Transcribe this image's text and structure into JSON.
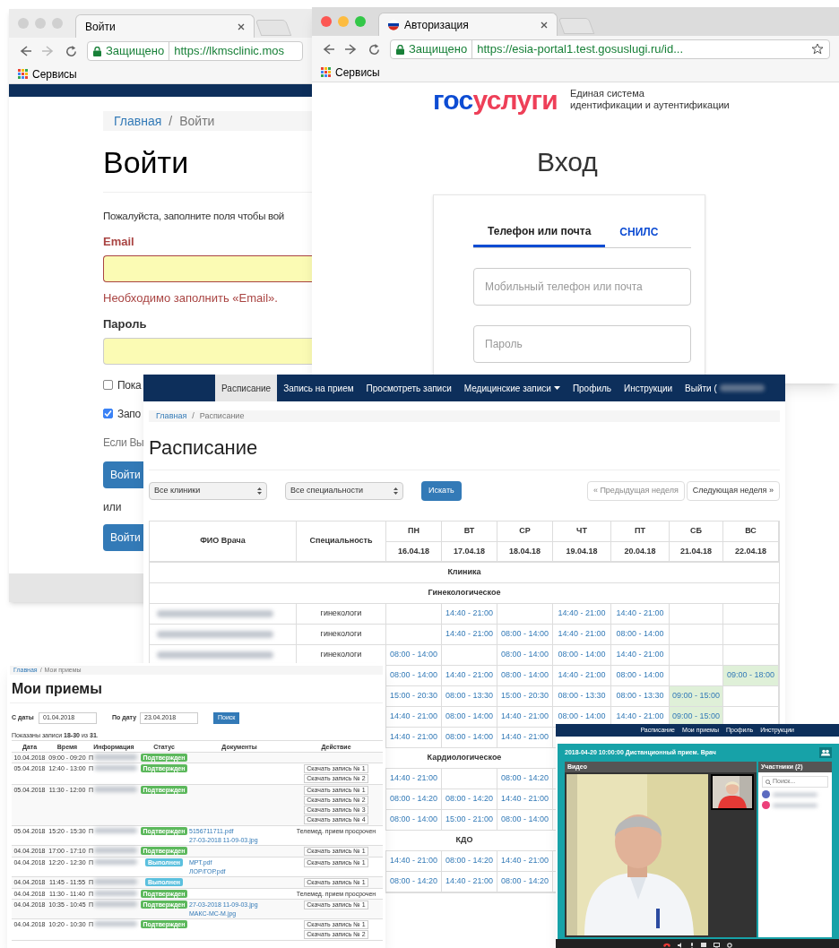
{
  "login_window": {
    "tab_title": "Войти",
    "secure_label": "Защищено",
    "url": "https://lkmsclinic.mos",
    "bookmark": "Сервисы",
    "breadcrumb": [
      "Главная",
      "/",
      "Войти"
    ],
    "heading": "Войти",
    "intro": "Пожалуйста, заполните поля чтобы вой",
    "fields": [
      {
        "label": "Email",
        "invalid": true,
        "error": "Необходимо заполнить «Email»."
      },
      {
        "label": "Пароль",
        "invalid": false
      }
    ],
    "checkboxes": [
      {
        "label": "Пока",
        "checked": false
      },
      {
        "label": "Запо",
        "checked": true
      }
    ],
    "note": "Если Вы",
    "buttons": [
      "Войти",
      "Войти"
    ],
    "or_label": "или"
  },
  "esia_window": {
    "tab_title": "Авторизация",
    "secure_label": "Защищено",
    "url": "https://esia-portal1.test.gosuslugi.ru/id...",
    "bookmark": "Сервисы",
    "logo_left": "гос",
    "logo_right": "услуги",
    "tagline": [
      "Единая система",
      "идентификации и аутентификации"
    ],
    "heading": "Вход",
    "tabs": [
      {
        "label": "Телефон или почта",
        "selected": true
      },
      {
        "label": "СНИЛС",
        "selected": false
      }
    ],
    "fields": [
      {
        "placeholder": "Мобильный телефон или почта"
      },
      {
        "placeholder": "Пароль"
      }
    ]
  },
  "schedule_window": {
    "nav": [
      {
        "label": "Расписание",
        "selected": true
      },
      {
        "label": "Запись на прием",
        "selected": false
      },
      {
        "label": "Просмотреть записи",
        "selected": false
      },
      {
        "label": "Медицинские записи",
        "selected": false,
        "dropdown": true
      },
      {
        "label": "Профиль",
        "selected": false
      },
      {
        "label": "Инструкции",
        "selected": false
      },
      {
        "label": "Выйти (",
        "selected": false,
        "redacted": true
      }
    ],
    "breadcrumb": [
      "Главная",
      "/",
      "Расписание"
    ],
    "heading": "Расписание",
    "filters": [
      "Все клиники",
      "Все специальности"
    ],
    "search_button": "Искать",
    "pager": [
      {
        "label": "« Предыдущая неделя",
        "disabled": true
      },
      {
        "label": "Следующая неделя »",
        "disabled": false
      }
    ],
    "columns": [
      "ФИО Врача",
      "Специальность"
    ],
    "days": [
      {
        "day": "ПН",
        "date": "16.04.18"
      },
      {
        "day": "ВТ",
        "date": "17.04.18"
      },
      {
        "day": "СР",
        "date": "18.04.18"
      },
      {
        "day": "ЧТ",
        "date": "19.04.18"
      },
      {
        "day": "ПТ",
        "date": "20.04.18"
      },
      {
        "day": "СБ",
        "date": "21.04.18"
      },
      {
        "day": "ВС",
        "date": "22.04.18"
      }
    ],
    "rows": [
      {
        "kind": "group",
        "title": "Клиника"
      },
      {
        "kind": "group",
        "title": "Гинекологическое"
      },
      {
        "kind": "doctor",
        "redacted": true,
        "specialty": "гинекологи",
        "slots": [
          {
            "kind": "empty"
          },
          {
            "kind": "time",
            "time": "14:40 - 21:00",
            "highlighted": false
          },
          {
            "kind": "empty"
          },
          {
            "kind": "time",
            "time": "14:40 - 21:00",
            "highlighted": false
          },
          {
            "kind": "time",
            "time": "14:40 - 21:00",
            "highlighted": false
          },
          {
            "kind": "empty"
          },
          {
            "kind": "empty"
          }
        ]
      },
      {
        "kind": "doctor",
        "redacted": true,
        "specialty": "гинекологи",
        "slots": [
          {
            "kind": "empty"
          },
          {
            "kind": "time",
            "time": "14:40 - 21:00",
            "highlighted": false
          },
          {
            "kind": "time",
            "time": "08:00 - 14:00",
            "highlighted": false
          },
          {
            "kind": "time",
            "time": "14:40 - 21:00",
            "highlighted": false
          },
          {
            "kind": "time",
            "time": "08:00 - 14:00",
            "highlighted": false
          },
          {
            "kind": "empty"
          },
          {
            "kind": "empty"
          }
        ]
      },
      {
        "kind": "doctor",
        "redacted": true,
        "specialty": "гинекологи",
        "slots": [
          {
            "kind": "time",
            "time": "08:00 - 14:00",
            "highlighted": false
          },
          {
            "kind": "empty"
          },
          {
            "kind": "time",
            "time": "08:00 - 14:00",
            "highlighted": false
          },
          {
            "kind": "time",
            "time": "08:00 - 14:00",
            "highlighted": false
          },
          {
            "kind": "time",
            "time": "14:40 - 21:00",
            "highlighted": false
          },
          {
            "kind": "empty"
          },
          {
            "kind": "empty"
          }
        ]
      },
      {
        "kind": "doctor",
        "slots": [
          {
            "kind": "time",
            "time": "08:00 - 14:00",
            "highlighted": false
          },
          {
            "kind": "time",
            "time": "14:40 - 21:00",
            "highlighted": false
          },
          {
            "kind": "time",
            "time": "08:00 - 14:00",
            "highlighted": false
          },
          {
            "kind": "time",
            "time": "14:40 - 21:00",
            "highlighted": false
          },
          {
            "kind": "time",
            "time": "08:00 - 14:00",
            "highlighted": false
          },
          {
            "kind": "empty"
          },
          {
            "kind": "time",
            "time": "09:00 - 18:00",
            "highlighted": true
          }
        ]
      },
      {
        "kind": "doctor",
        "slots": [
          {
            "kind": "time",
            "time": "15:00 - 20:30",
            "highlighted": false
          },
          {
            "kind": "time",
            "time": "08:00 - 13:30",
            "highlighted": false
          },
          {
            "kind": "time",
            "time": "15:00 - 20:30",
            "highlighted": false
          },
          {
            "kind": "time",
            "time": "08:00 - 13:30",
            "highlighted": false
          },
          {
            "kind": "time",
            "time": "08:00 - 13:30",
            "highlighted": false
          },
          {
            "kind": "time",
            "time": "09:00 - 15:00",
            "highlighted": true
          },
          {
            "kind": "empty"
          }
        ]
      },
      {
        "kind": "doctor",
        "slots": [
          {
            "kind": "time",
            "time": "14:40 - 21:00",
            "highlighted": false
          },
          {
            "kind": "time",
            "time": "08:00 - 14:00",
            "highlighted": false
          },
          {
            "kind": "time",
            "time": "14:40 - 21:00",
            "highlighted": false
          },
          {
            "kind": "time",
            "time": "08:00 - 14:00",
            "highlighted": false
          },
          {
            "kind": "time",
            "time": "14:40 - 21:00",
            "highlighted": false
          },
          {
            "kind": "time",
            "time": "09:00 - 15:00",
            "highlighted": true
          },
          {
            "kind": "empty"
          }
        ]
      },
      {
        "kind": "doctor",
        "slots": [
          {
            "kind": "time",
            "time": "14:40 - 21:00",
            "highlighted": false
          },
          {
            "kind": "time",
            "time": "08:00 - 14:00",
            "highlighted": false
          },
          {
            "kind": "time",
            "time": "14:40 - 21:00",
            "highlighted": false
          }
        ]
      },
      {
        "kind": "group",
        "title": "Кардиологическое"
      },
      {
        "kind": "doctor",
        "slots": [
          {
            "kind": "time",
            "time": "14:40 - 21:00",
            "highlighted": false
          },
          {
            "kind": "empty"
          },
          {
            "kind": "time",
            "time": "08:00 - 14:20",
            "highlighted": false
          }
        ]
      },
      {
        "kind": "doctor",
        "slots": [
          {
            "kind": "time",
            "time": "08:00 - 14:20",
            "highlighted": false
          },
          {
            "kind": "time",
            "time": "08:00 - 14:20",
            "highlighted": false
          },
          {
            "kind": "time",
            "time": "14:40 - 21:00",
            "highlighted": false
          }
        ]
      },
      {
        "kind": "doctor",
        "slots": [
          {
            "kind": "time",
            "time": "08:00 - 14:00",
            "highlighted": false
          },
          {
            "kind": "time",
            "time": "15:00 - 21:00",
            "highlighted": false
          },
          {
            "kind": "time",
            "time": "08:00 - 14:00",
            "highlighted": false
          }
        ]
      },
      {
        "kind": "group",
        "title": "КДО"
      },
      {
        "kind": "doctor",
        "slots": [
          {
            "kind": "time",
            "time": "14:40 - 21:00",
            "highlighted": false
          },
          {
            "kind": "time",
            "time": "08:00 - 14:20",
            "highlighted": false
          },
          {
            "kind": "time",
            "time": "14:40 - 21:00",
            "highlighted": false
          }
        ]
      },
      {
        "kind": "doctor",
        "slots": [
          {
            "kind": "time",
            "time": "08:00 - 14:20",
            "highlighted": false
          },
          {
            "kind": "time",
            "time": "14:40 - 21:00",
            "highlighted": false
          },
          {
            "kind": "time",
            "time": "08:00 - 14:20",
            "highlighted": false
          }
        ]
      }
    ]
  },
  "appointments_window": {
    "breadcrumb": [
      "Главная",
      "/",
      "Мои приемы"
    ],
    "heading": "Мои приемы",
    "from_label": "С даты",
    "from_value": "01.04.2018",
    "to_label": "По дату",
    "to_value": "23.04.2018",
    "search_button": "Поиск",
    "summary": "Показаны записи **18-30** из **31**.",
    "columns": [
      "Дата",
      "Время",
      "Информация",
      "Статус",
      "Документы",
      "Действие"
    ],
    "rows": [
      {
        "date": "10.04.2018",
        "time": "09:00 - 09:20",
        "info": "П",
        "status": "Подтвержден",
        "kind": "confirmed"
      },
      {
        "date": "05.04.2018",
        "time": "12:40 - 13:00",
        "info": "П",
        "status": "Подтвержден",
        "kind": "confirmed",
        "actions": [
          "Скачать запись № 1",
          "Скачать запись № 2"
        ]
      },
      {
        "date": "05.04.2018",
        "time": "11:30 - 12:00",
        "info": "П",
        "status": "Подтвержден",
        "kind": "confirmed",
        "actions": [
          "Скачать запись № 1",
          "Скачать запись № 2",
          "Скачать запись № 3",
          "Скачать запись № 4"
        ]
      },
      {
        "date": "05.04.2018",
        "time": "15:20 - 15:30",
        "info": "П",
        "status": "Подтвержден",
        "kind": "confirmed",
        "documents": [
          "5156711711.pdf",
          "27-03-2018 11-09-03.jpg"
        ],
        "note": "Телемед. прием просрочен"
      },
      {
        "date": "04.04.2018",
        "time": "17:00 - 17:10",
        "info": "П",
        "status": "Подтвержден",
        "kind": "confirmed",
        "actions": [
          "Скачать запись № 1"
        ]
      },
      {
        "date": "04.04.2018",
        "time": "12:20 - 12:30",
        "info": "П",
        "status": "Выполнен",
        "kind": "done",
        "documents": [
          "МРТ.pdf",
          "ЛОР/ГОР.pdf"
        ],
        "actions": [
          "Скачать запись № 1"
        ]
      },
      {
        "date": "04.04.2018",
        "time": "11:45 - 11:55",
        "info": "П",
        "status": "Выполнен",
        "kind": "done",
        "actions": [
          "Скачать запись № 1"
        ]
      },
      {
        "date": "04.04.2018",
        "time": "11:30 - 11:40",
        "info": "П",
        "status": "Подтвержден",
        "kind": "confirmed",
        "note": "Телемед. прием просрочен"
      },
      {
        "date": "04.04.2018",
        "time": "10:35 - 10:45",
        "info": "П",
        "status": "Подтвержден",
        "kind": "confirmed",
        "documents": [
          "27-03-2018 11-09-03.jpg",
          "МАКС-МС-М.jpg"
        ],
        "actions": [
          "Скачать запись № 1"
        ]
      },
      {
        "date": "04.04.2018",
        "time": "10:20 - 10:30",
        "info": "П",
        "status": "Подтвержден",
        "kind": "confirmed",
        "actions": [
          "Скачать запись № 1",
          "Скачать запись № 2"
        ]
      }
    ]
  },
  "video_window": {
    "nav": [
      "Расписание",
      "Мои приемы",
      "Профиль",
      "Инструкции"
    ],
    "title": "2018-04-20 10:00:00 Дистанционный прием. Врач",
    "video_label": "Видео",
    "participants_label": "Участники (2)",
    "search_placeholder": "Поиск...",
    "participants": [
      {
        "color": "#5c6bc0"
      },
      {
        "color": "#ec407a"
      }
    ]
  }
}
